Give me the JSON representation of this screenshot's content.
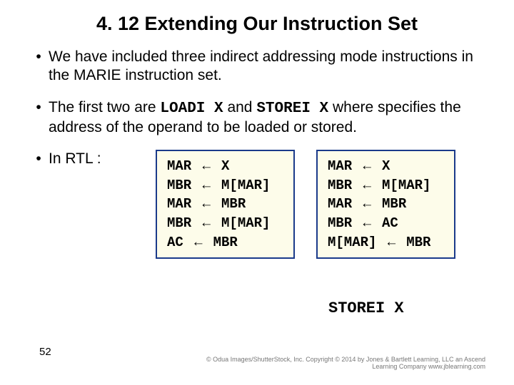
{
  "title": "4. 12 Extending Our Instruction Set",
  "bullets": {
    "b1": "We have included three indirect addressing mode instructions in the MARIE instruction set.",
    "b2_pre": "The first two are ",
    "b2_code1": "LOADI X",
    "b2_mid": " and ",
    "b2_code2": "STOREI X",
    "b2_post": " where specifies the address of the operand to be loaded or stored.",
    "b3": "In RTL :"
  },
  "rtl_left": {
    "l1_a": "MAR",
    "l1_b": "X",
    "l2_a": "MBR",
    "l2_b": "M[MAR]",
    "l3_a": "MAR",
    "l3_b": "MBR",
    "l4_a": "MBR",
    "l4_b": "M[MAR]",
    "l5_a": "AC",
    "l5_b": "MBR"
  },
  "rtl_right": {
    "l1_a": "MAR",
    "l1_b": "X",
    "l2_a": "MBR",
    "l2_b": "M[MAR]",
    "l3_a": "MAR",
    "l3_b": "MBR",
    "l4_a": "MBR",
    "l4_b": "AC",
    "l5_a": "M[MAR]",
    "l5_b": "MBR"
  },
  "arrow": "←",
  "storei_caption": "STOREI X",
  "page_number": "52",
  "copyright": "© Odua Images/ShutterStock, Inc. Copyright © 2014 by Jones & Bartlett Learning, LLC an Ascend Learning Company  www.jblearning.com"
}
